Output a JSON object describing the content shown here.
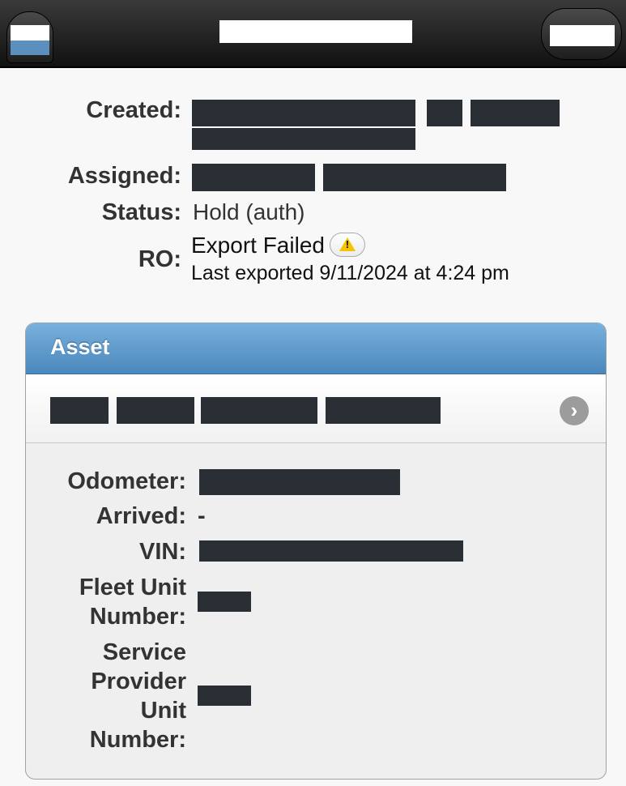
{
  "summary": {
    "created_label": "Created:",
    "assigned_label": "Assigned:",
    "status_label": "Status:",
    "status_value": "Hold (auth)",
    "ro_label": "RO:",
    "ro_value": "Export Failed",
    "ro_warning_icon": "warning-icon",
    "ro_last_exported": "Last exported 9/11/2024 at 4:24 pm"
  },
  "asset": {
    "title": "Asset",
    "nav_icon": "chevron-right-icon",
    "nav_glyph": "›",
    "fields": {
      "odometer_label": "Odometer:",
      "arrived_label": "Arrived:",
      "arrived_value": "-",
      "vin_label": "VIN:",
      "fleet_unit_label_1": "Fleet Unit",
      "fleet_unit_label_2": "Number:",
      "service_provider_label_1": "Service",
      "service_provider_label_2": "Provider",
      "service_provider_label_3": "Unit",
      "service_provider_label_4": "Number:"
    }
  },
  "colors": {
    "header_bg": "#1a1a1a",
    "panel_head": "#5b97c8",
    "redaction": "#2a2f35"
  }
}
